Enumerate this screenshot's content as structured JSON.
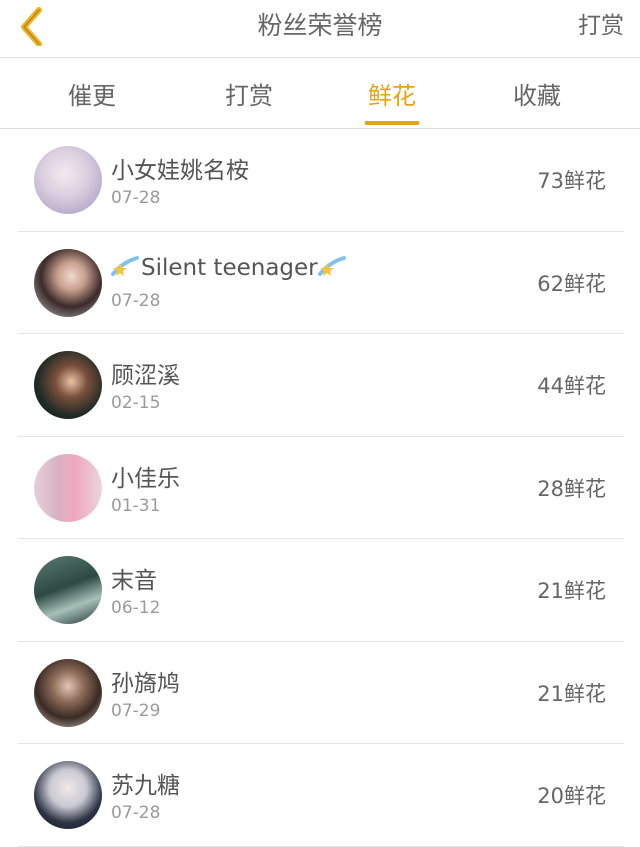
{
  "header": {
    "title": "粉丝荣誉榜",
    "action_label": "打赏"
  },
  "tabs": [
    {
      "label": "催更",
      "active": false
    },
    {
      "label": "打赏",
      "active": false
    },
    {
      "label": "鲜花",
      "active": true
    },
    {
      "label": "收藏",
      "active": false
    }
  ],
  "colors": {
    "accent": "#e8a311",
    "text": "#555555",
    "muted": "#9a9a9a",
    "divider": "#e4e4e4"
  },
  "fans": [
    {
      "name": "小女娃姚名桉",
      "date": "07-28",
      "count": "73鲜花"
    },
    {
      "name": "Silent teenager",
      "date": "07-28",
      "count": "62鲜花",
      "decor_icon": "shooting-star-icon"
    },
    {
      "name": "顾涩溪",
      "date": "02-15",
      "count": "44鲜花"
    },
    {
      "name": "小佳乐",
      "date": "01-31",
      "count": "28鲜花"
    },
    {
      "name": "末音",
      "date": "06-12",
      "count": "21鲜花"
    },
    {
      "name": "孙旖鸠",
      "date": "07-29",
      "count": "21鲜花"
    },
    {
      "name": "苏九糖",
      "date": "07-28",
      "count": "20鲜花"
    }
  ]
}
